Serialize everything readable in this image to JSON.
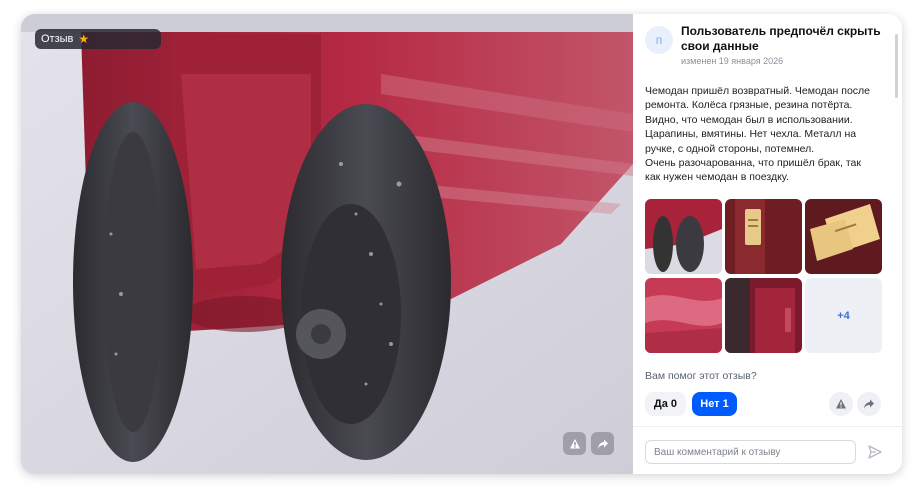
{
  "photo": {
    "badge_label": "Отзыв",
    "badge_icon": "star-icon",
    "report_icon": "warning-icon",
    "share_icon": "share-icon"
  },
  "review": {
    "avatar_letter": "п",
    "author": "Пользователь предпочёл скрыть свои данные",
    "date": "изменен 19 января 2026",
    "text_lines": [
      "Чемодан пришёл возвратный. Чемодан после",
      "ремонта. Колёса грязные, резина потёрта.",
      "Видно, что чемодан был в использовании.",
      "Царапины, вмятины. Нет чехла. Металл на",
      "ручке, с одной стороны, потемнел.",
      "Очень разочарованна, что пришёл брак, так",
      "как нужен чемодан в поездку."
    ],
    "more_photos_label": "+4"
  },
  "feedback": {
    "question": "Вам помог этот отзыв?",
    "yes_label": "Да 0",
    "no_label": "Нет 1"
  },
  "comment": {
    "placeholder": "Ваш комментарий к отзыву",
    "send_icon": "send-icon"
  },
  "colors": {
    "accent": "#005bff",
    "suitcase_red": "#a8223a",
    "star": "#ffb400"
  }
}
